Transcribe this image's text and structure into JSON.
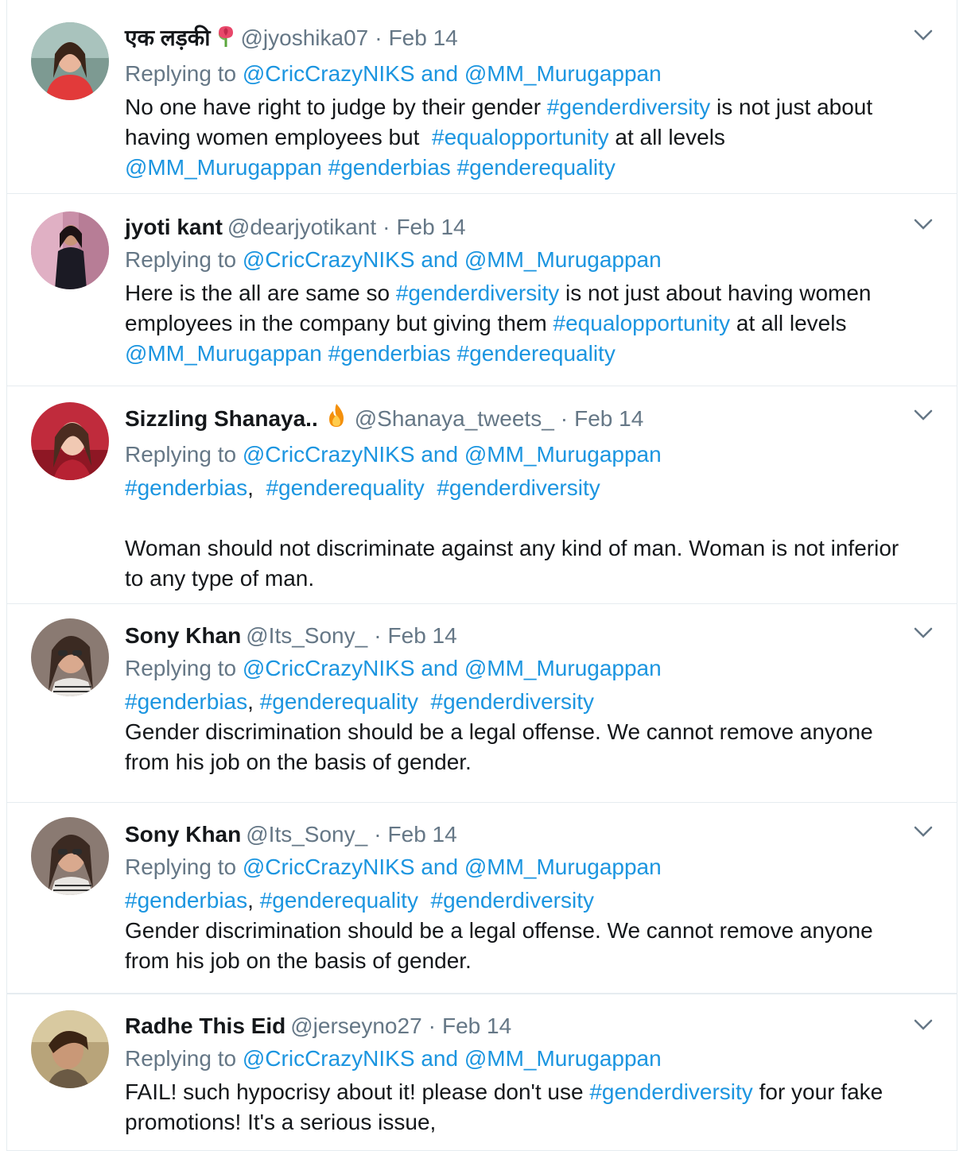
{
  "tweets": [
    {
      "name": "एक लड़की",
      "handle": "@jyoshika07",
      "sep": "·",
      "date": "Feb 14",
      "reply_prefix": "Replying to",
      "reply_to_1": "@CricCrazyNIKS",
      "reply_and": "and",
      "reply_to_2": "@MM_Murugappan",
      "emoji_icon": "rose-emoji-icon",
      "lines": [
        [
          {
            "t": "No one have right to judge by their gender ",
            "link": false
          },
          {
            "t": "#genderdiversity",
            "link": true
          },
          {
            "t": " is not just about",
            "link": false
          }
        ],
        [
          {
            "t": "having women employees but  ",
            "link": false
          },
          {
            "t": "#equalopportunity",
            "link": true
          },
          {
            "t": " at all levels",
            "link": false
          }
        ],
        [
          {
            "t": "@MM_Murugappan",
            "link": true
          },
          {
            "t": " ",
            "link": false
          },
          {
            "t": "#genderbias",
            "link": true
          },
          {
            "t": " ",
            "link": false
          },
          {
            "t": "#genderequality",
            "link": true
          }
        ]
      ]
    },
    {
      "name": "jyoti kant",
      "handle": "@dearjyotikant",
      "sep": "·",
      "date": "Feb 14",
      "reply_prefix": "Replying to",
      "reply_to_1": "@CricCrazyNIKS",
      "reply_and": "and",
      "reply_to_2": "@MM_Murugappan",
      "lines": [
        [
          {
            "t": "Here is the all are same so ",
            "link": false
          },
          {
            "t": "#genderdiversity",
            "link": true
          },
          {
            "t": " is not just about having women",
            "link": false
          }
        ],
        [
          {
            "t": "employees in the company but giving them ",
            "link": false
          },
          {
            "t": "#equalopportunity",
            "link": true
          },
          {
            "t": " at all levels",
            "link": false
          }
        ],
        [
          {
            "t": "@MM_Murugappan",
            "link": true
          },
          {
            "t": " ",
            "link": false
          },
          {
            "t": "#genderbias",
            "link": true
          },
          {
            "t": " ",
            "link": false
          },
          {
            "t": "#genderequality",
            "link": true
          }
        ]
      ]
    },
    {
      "name": "Sizzling Shanaya..",
      "handle": "@Shanaya_tweets_",
      "sep": "·",
      "date": "Feb 14",
      "reply_prefix": "Replying to",
      "reply_to_1": "@CricCrazyNIKS",
      "reply_and": "and",
      "reply_to_2": "@MM_Murugappan",
      "emoji_icon": "fire-emoji-icon",
      "lines": [
        [
          {
            "t": "#genderbias",
            "link": true
          },
          {
            "t": ",  ",
            "link": false
          },
          {
            "t": "#genderequality",
            "link": true
          },
          {
            "t": "  ",
            "link": false
          },
          {
            "t": "#genderdiversity",
            "link": true
          }
        ],
        [],
        [
          {
            "t": "Woman should not discriminate against any kind of man. Woman is not inferior",
            "link": false
          }
        ],
        [
          {
            "t": "to any type of man.",
            "link": false
          }
        ]
      ]
    },
    {
      "name": "Sony Khan",
      "handle": "@Its_Sony_",
      "sep": "·",
      "date": "Feb 14",
      "reply_prefix": "Replying to",
      "reply_to_1": "@CricCrazyNIKS",
      "reply_and": "and",
      "reply_to_2": "@MM_Murugappan",
      "lines": [
        [
          {
            "t": "#genderbias",
            "link": true
          },
          {
            "t": ", ",
            "link": false
          },
          {
            "t": "#genderequality",
            "link": true
          },
          {
            "t": "  ",
            "link": false
          },
          {
            "t": "#genderdiversity",
            "link": true
          }
        ],
        [
          {
            "t": "Gender discrimination should be a legal offense. We cannot remove anyone",
            "link": false
          }
        ],
        [
          {
            "t": "from his job on the basis of gender.",
            "link": false
          }
        ]
      ]
    },
    {
      "name": "Sony Khan",
      "handle": "@Its_Sony_",
      "sep": "·",
      "date": "Feb 14",
      "reply_prefix": "Replying to",
      "reply_to_1": "@CricCrazyNIKS",
      "reply_and": "and",
      "reply_to_2": "@MM_Murugappan",
      "lines": [
        [
          {
            "t": "#genderbias",
            "link": true
          },
          {
            "t": ", ",
            "link": false
          },
          {
            "t": "#genderequality",
            "link": true
          },
          {
            "t": "  ",
            "link": false
          },
          {
            "t": "#genderdiversity",
            "link": true
          }
        ],
        [
          {
            "t": "Gender discrimination should be a legal offense. We cannot remove anyone",
            "link": false
          }
        ],
        [
          {
            "t": "from his job on the basis of gender.",
            "link": false
          }
        ]
      ]
    },
    {
      "name": "Radhe This Eid",
      "handle": "@jerseyno27",
      "sep": "·",
      "date": "Feb 14",
      "reply_prefix": "Replying to",
      "reply_to_1": "@CricCrazyNIKS",
      "reply_and": "and",
      "reply_to_2": "@MM_Murugappan",
      "lines": [
        [
          {
            "t": "FAIL! such hypocrisy about it! please don't use ",
            "link": false
          },
          {
            "t": "#genderdiversity",
            "link": true
          },
          {
            "t": " for your fake",
            "link": false
          }
        ],
        [
          {
            "t": "promotions! It's a serious issue,",
            "link": false
          }
        ]
      ]
    }
  ],
  "icons": {
    "caret": "chevron-down-icon",
    "avatar": "avatar"
  },
  "colors": {
    "link": "#1b95e0",
    "muted": "#657786",
    "text": "#14171a",
    "border": "#e6ecf0"
  }
}
